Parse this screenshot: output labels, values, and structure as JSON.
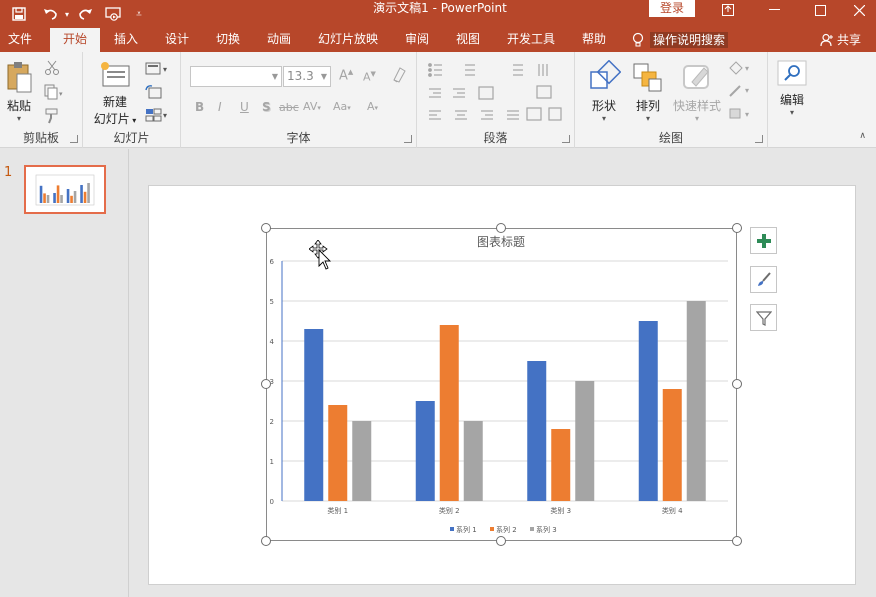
{
  "window": {
    "title": "演示文稿1  -  PowerPoint",
    "login_label": "登录"
  },
  "tabs": [
    {
      "label": "文件"
    },
    {
      "label": "开始"
    },
    {
      "label": "插入"
    },
    {
      "label": "设计"
    },
    {
      "label": "切换"
    },
    {
      "label": "动画"
    },
    {
      "label": "幻灯片放映"
    },
    {
      "label": "审阅"
    },
    {
      "label": "视图"
    },
    {
      "label": "开发工具"
    },
    {
      "label": "帮助"
    }
  ],
  "tell_me": {
    "label": "操作说明搜索"
  },
  "share": {
    "label": "共享"
  },
  "ribbon": {
    "clipboard": {
      "paste_label": "粘贴",
      "group_label": "剪贴板"
    },
    "slides": {
      "new_slide_line1": "新建",
      "new_slide_line2": "幻灯片",
      "group_label": "幻灯片"
    },
    "font": {
      "font_name": "",
      "font_size": "13.3",
      "group_label": "字体"
    },
    "paragraph": {
      "group_label": "段落"
    },
    "drawing": {
      "shapes_label": "形状",
      "arrange_label": "排列",
      "quick_styles_label": "快速样式",
      "group_label": "绘图"
    },
    "editing": {
      "edit_label": "编辑"
    }
  },
  "thumbnail": {
    "slide_number": "1"
  },
  "chart_data": {
    "type": "bar",
    "title": "图表标题",
    "categories": [
      "类别 1",
      "类别 2",
      "类别 3",
      "类别 4"
    ],
    "series": [
      {
        "name": "系列 1",
        "color": "#4472c4",
        "values": [
          4.3,
          2.5,
          3.5,
          4.5
        ]
      },
      {
        "name": "系列 2",
        "color": "#ed7d31",
        "values": [
          2.4,
          4.4,
          1.8,
          2.8
        ]
      },
      {
        "name": "系列 3",
        "color": "#a5a5a5",
        "values": [
          2,
          2,
          3,
          5
        ]
      }
    ],
    "ylim": [
      0,
      6
    ],
    "yticks": [
      "0",
      "1",
      "2",
      "3",
      "4",
      "5",
      "6"
    ],
    "grid": true,
    "legend_position": "bottom"
  },
  "colors": {
    "accent": "#b7472a",
    "selection": "#e46c4a"
  }
}
